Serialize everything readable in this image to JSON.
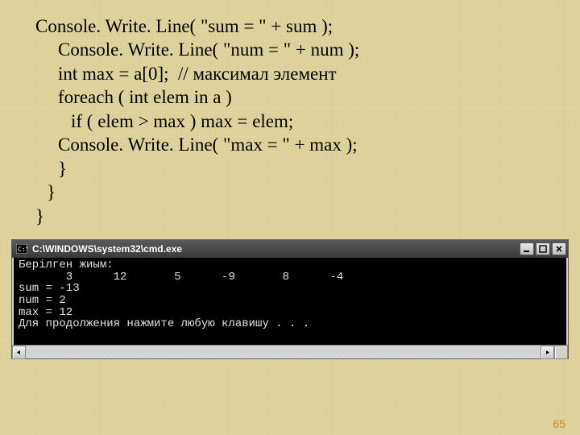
{
  "code": {
    "l1": "Console. Write. Line( \"sum = \" + sum );",
    "l2": "Console. Write. Line( \"num = \" + num );",
    "l3": "int max = a[0];  // максимал элемент",
    "l4": "foreach ( int elem in a )",
    "l5": "if ( elem > max ) max = elem;",
    "l6": "Console. Write. Line( \"max = \" + max );",
    "l7": "}",
    "l8": "}",
    "l9": "}"
  },
  "cmd": {
    "title": "C:\\WINDOWS\\system32\\cmd.exe",
    "output": {
      "line1": "Берілген жиым:",
      "line2": "       3      12       5      -9       8      -4",
      "line3": "sum = -13",
      "line4": "num = 2",
      "line5": "max = 12",
      "line6": "Для продолжения нажмите любую клавишу . . ."
    }
  },
  "page_number": "65",
  "icons": {
    "app": "cmd-app-icon",
    "minimize": "minimize-icon",
    "maximize": "maximize-icon",
    "close": "close-icon",
    "left": "scroll-left-icon",
    "right": "scroll-right-icon"
  }
}
